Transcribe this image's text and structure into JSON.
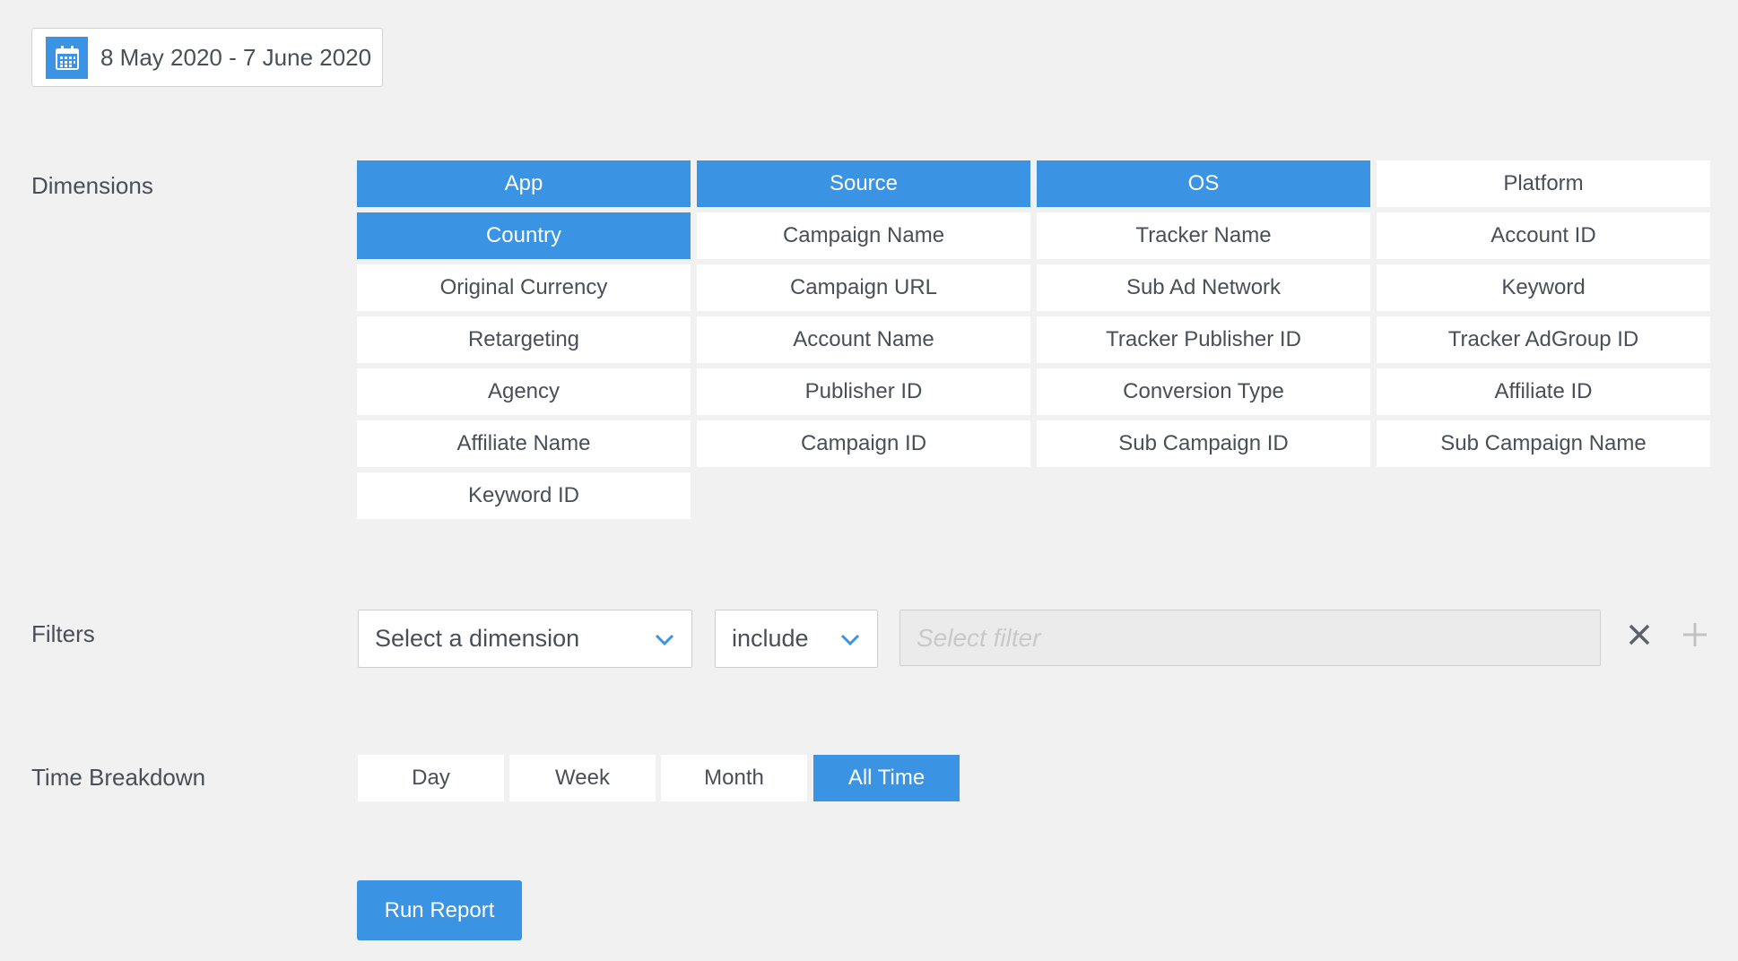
{
  "date_range": {
    "label": "8 May 2020 - 7 June 2020",
    "icon": "calendar-icon"
  },
  "dimensions": {
    "label": "Dimensions",
    "items": [
      {
        "label": "App",
        "selected": true
      },
      {
        "label": "Source",
        "selected": true
      },
      {
        "label": "OS",
        "selected": true
      },
      {
        "label": "Platform",
        "selected": false
      },
      {
        "label": "Country",
        "selected": true
      },
      {
        "label": "Campaign Name",
        "selected": false
      },
      {
        "label": "Tracker Name",
        "selected": false
      },
      {
        "label": "Account ID",
        "selected": false
      },
      {
        "label": "Original Currency",
        "selected": false
      },
      {
        "label": "Campaign URL",
        "selected": false
      },
      {
        "label": "Sub Ad Network",
        "selected": false
      },
      {
        "label": "Keyword",
        "selected": false
      },
      {
        "label": "Retargeting",
        "selected": false
      },
      {
        "label": "Account Name",
        "selected": false
      },
      {
        "label": "Tracker Publisher ID",
        "selected": false
      },
      {
        "label": "Tracker AdGroup ID",
        "selected": false
      },
      {
        "label": "Agency",
        "selected": false
      },
      {
        "label": "Publisher ID",
        "selected": false
      },
      {
        "label": "Conversion Type",
        "selected": false
      },
      {
        "label": "Affiliate ID",
        "selected": false
      },
      {
        "label": "Affiliate Name",
        "selected": false
      },
      {
        "label": "Campaign ID",
        "selected": false
      },
      {
        "label": "Sub Campaign ID",
        "selected": false
      },
      {
        "label": "Sub Campaign Name",
        "selected": false
      },
      {
        "label": "Keyword ID",
        "selected": false
      }
    ]
  },
  "filters": {
    "label": "Filters",
    "dimension_select": "Select a dimension",
    "mode_select": "include",
    "filter_placeholder": "Select filter"
  },
  "time_breakdown": {
    "label": "Time Breakdown",
    "options": [
      {
        "label": "Day",
        "selected": false
      },
      {
        "label": "Week",
        "selected": false
      },
      {
        "label": "Month",
        "selected": false
      },
      {
        "label": "All Time",
        "selected": true
      }
    ]
  },
  "run_button": "Run Report",
  "colors": {
    "accent": "#3a93e3",
    "background": "#f1f1f1",
    "text": "#4a4f57"
  }
}
